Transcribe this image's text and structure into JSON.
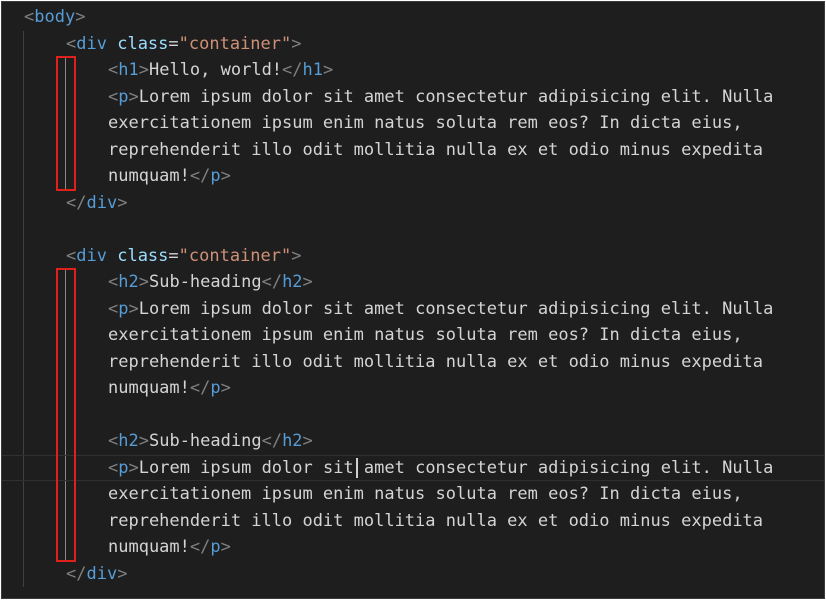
{
  "editor": {
    "lines": [
      {
        "indent": 0,
        "parts": [
          [
            "punct",
            "<"
          ],
          [
            "tag",
            "body"
          ],
          [
            "punct",
            ">"
          ]
        ]
      },
      {
        "indent": 1,
        "parts": [
          [
            "punct",
            "<"
          ],
          [
            "tag",
            "div"
          ],
          [
            "txt",
            " "
          ],
          [
            "attr",
            "class"
          ],
          [
            "txt",
            "="
          ],
          [
            "str",
            "\"container\""
          ],
          [
            "punct",
            ">"
          ]
        ]
      },
      {
        "indent": 2,
        "parts": [
          [
            "punct",
            "<"
          ],
          [
            "tag",
            "h1"
          ],
          [
            "punct",
            ">"
          ],
          [
            "txt",
            "Hello, world!"
          ],
          [
            "punct",
            "</"
          ],
          [
            "tag",
            "h1"
          ],
          [
            "punct",
            ">"
          ]
        ]
      },
      {
        "indent": 2,
        "parts": [
          [
            "punct",
            "<"
          ],
          [
            "tag",
            "p"
          ],
          [
            "punct",
            ">"
          ],
          [
            "txt",
            "Lorem ipsum dolor sit amet consectetur adipisicing elit. Nulla"
          ]
        ]
      },
      {
        "indent": 2,
        "parts": [
          [
            "txt",
            "exercitationem ipsum enim natus soluta rem eos? In dicta eius,"
          ]
        ]
      },
      {
        "indent": 2,
        "parts": [
          [
            "txt",
            "reprehenderit illo odit mollitia nulla ex et odio minus expedita"
          ]
        ]
      },
      {
        "indent": 2,
        "parts": [
          [
            "txt",
            "numquam!"
          ],
          [
            "punct",
            "</"
          ],
          [
            "tag",
            "p"
          ],
          [
            "punct",
            ">"
          ]
        ]
      },
      {
        "indent": 1,
        "parts": [
          [
            "punct",
            "</"
          ],
          [
            "tag",
            "div"
          ],
          [
            "punct",
            ">"
          ]
        ]
      },
      {
        "indent": 0,
        "parts": []
      },
      {
        "indent": 1,
        "parts": [
          [
            "punct",
            "<"
          ],
          [
            "tag",
            "div"
          ],
          [
            "txt",
            " "
          ],
          [
            "attr",
            "class"
          ],
          [
            "txt",
            "="
          ],
          [
            "str",
            "\"container\""
          ],
          [
            "punct",
            ">"
          ]
        ]
      },
      {
        "indent": 2,
        "parts": [
          [
            "punct",
            "<"
          ],
          [
            "tag",
            "h2"
          ],
          [
            "punct",
            ">"
          ],
          [
            "txt",
            "Sub-heading"
          ],
          [
            "punct",
            "</"
          ],
          [
            "tag",
            "h2"
          ],
          [
            "punct",
            ">"
          ]
        ]
      },
      {
        "indent": 2,
        "parts": [
          [
            "punct",
            "<"
          ],
          [
            "tag",
            "p"
          ],
          [
            "punct",
            ">"
          ],
          [
            "txt",
            "Lorem ipsum dolor sit amet consectetur adipisicing elit. Nulla"
          ]
        ]
      },
      {
        "indent": 2,
        "parts": [
          [
            "txt",
            "exercitationem ipsum enim natus soluta rem eos? In dicta eius,"
          ]
        ]
      },
      {
        "indent": 2,
        "parts": [
          [
            "txt",
            "reprehenderit illo odit mollitia nulla ex et odio minus expedita"
          ]
        ]
      },
      {
        "indent": 2,
        "parts": [
          [
            "txt",
            "numquam!"
          ],
          [
            "punct",
            "</"
          ],
          [
            "tag",
            "p"
          ],
          [
            "punct",
            ">"
          ]
        ]
      },
      {
        "indent": 0,
        "parts": []
      },
      {
        "indent": 2,
        "parts": [
          [
            "punct",
            "<"
          ],
          [
            "tag",
            "h2"
          ],
          [
            "punct",
            ">"
          ],
          [
            "txt",
            "Sub-heading"
          ],
          [
            "punct",
            "</"
          ],
          [
            "tag",
            "h2"
          ],
          [
            "punct",
            ">"
          ]
        ]
      },
      {
        "indent": 2,
        "current": true,
        "parts": [
          [
            "punct",
            "<"
          ],
          [
            "tag",
            "p"
          ],
          [
            "punct",
            ">"
          ],
          [
            "txt",
            "Lorem ipsum dolor sit amet consectetur adipisicing elit. Nulla"
          ]
        ]
      },
      {
        "indent": 2,
        "parts": [
          [
            "txt",
            "exercitationem ipsum enim natus soluta rem eos? In dicta eius,"
          ]
        ]
      },
      {
        "indent": 2,
        "parts": [
          [
            "txt",
            "reprehenderit illo odit mollitia nulla ex et odio minus expedita"
          ]
        ]
      },
      {
        "indent": 2,
        "parts": [
          [
            "txt",
            "numquam!"
          ],
          [
            "punct",
            "</"
          ],
          [
            "tag",
            "p"
          ],
          [
            "punct",
            ">"
          ]
        ]
      },
      {
        "indent": 1,
        "parts": [
          [
            "punct",
            "</"
          ],
          [
            "tag",
            "div"
          ],
          [
            "punct",
            ">"
          ]
        ]
      }
    ],
    "cursor": {
      "line": 17,
      "column": 24
    },
    "active_guides": [
      {
        "level": 2,
        "from_line": 2,
        "to_line": 6
      },
      {
        "level": 2,
        "from_line": 10,
        "to_line": 20
      }
    ],
    "highlight_boxes": [
      {
        "from_line": 2,
        "to_line": 6
      },
      {
        "from_line": 10,
        "to_line": 20
      }
    ],
    "colors": {
      "background": "#1e1e1e",
      "tag": "#569cd6",
      "bracket": "#808080",
      "attribute": "#9cdcfe",
      "string": "#ce9178",
      "text": "#d4d4d4",
      "highlight_box": "#e0201b"
    }
  }
}
